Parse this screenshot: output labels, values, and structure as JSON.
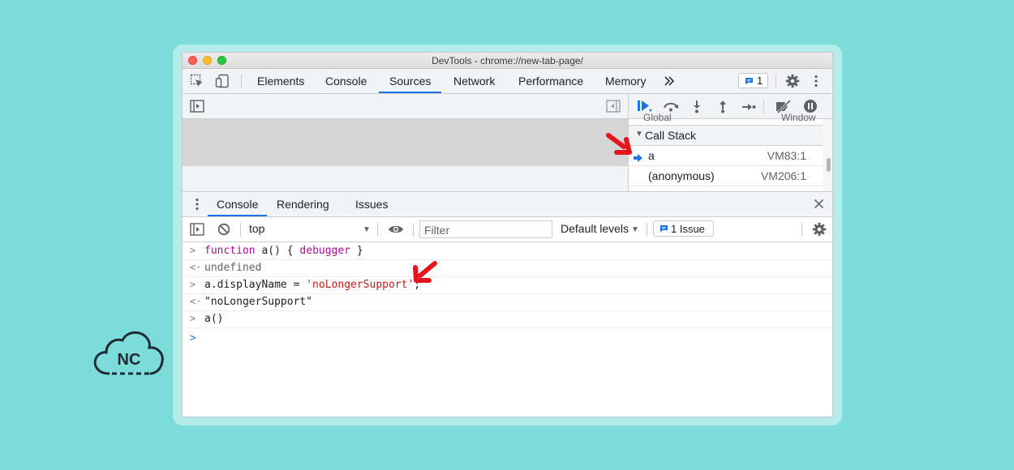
{
  "window": {
    "title": "DevTools - chrome://new-tab-page/"
  },
  "main_tabs": [
    {
      "label": "Elements",
      "active": false
    },
    {
      "label": "Console",
      "active": false
    },
    {
      "label": "Sources",
      "active": true
    },
    {
      "label": "Network",
      "active": false
    },
    {
      "label": "Performance",
      "active": false
    },
    {
      "label": "Memory",
      "active": false
    }
  ],
  "toolbar": {
    "issues_count": "1"
  },
  "debugger": {
    "scope_peek_left": "Global",
    "scope_peek_right": "Window",
    "call_stack_title": "Call Stack",
    "frames": [
      {
        "fn": "a",
        "loc": "VM83:1",
        "current": true
      },
      {
        "fn": "(anonymous)",
        "loc": "VM206:1",
        "current": false
      }
    ]
  },
  "drawer": {
    "tabs": [
      {
        "label": "Console",
        "active": true
      },
      {
        "label": "Rendering",
        "active": false
      },
      {
        "label": "Issues",
        "active": false
      }
    ]
  },
  "console_toolbar": {
    "context": "top",
    "filter_placeholder": "Filter",
    "levels": "Default levels",
    "issue_label": "1 Issue"
  },
  "console_lines": [
    {
      "prefix": ">",
      "parts": [
        "function",
        " a() { ",
        "debugger",
        " }"
      ]
    },
    {
      "prefix": "<·",
      "text": "undefined"
    },
    {
      "prefix": ">",
      "parts": [
        "a.displayName = ",
        "'noLongerSupport'",
        ";"
      ]
    },
    {
      "prefix": "<·",
      "text": "\"noLongerSupport\""
    },
    {
      "prefix": ">",
      "text": "a()"
    }
  ],
  "prompt_symbol": ">",
  "logo": {
    "text": "NC"
  },
  "colors": {
    "accent": "#1a73e8",
    "background": "#7cdcd9",
    "arrow": "#e8141c"
  }
}
